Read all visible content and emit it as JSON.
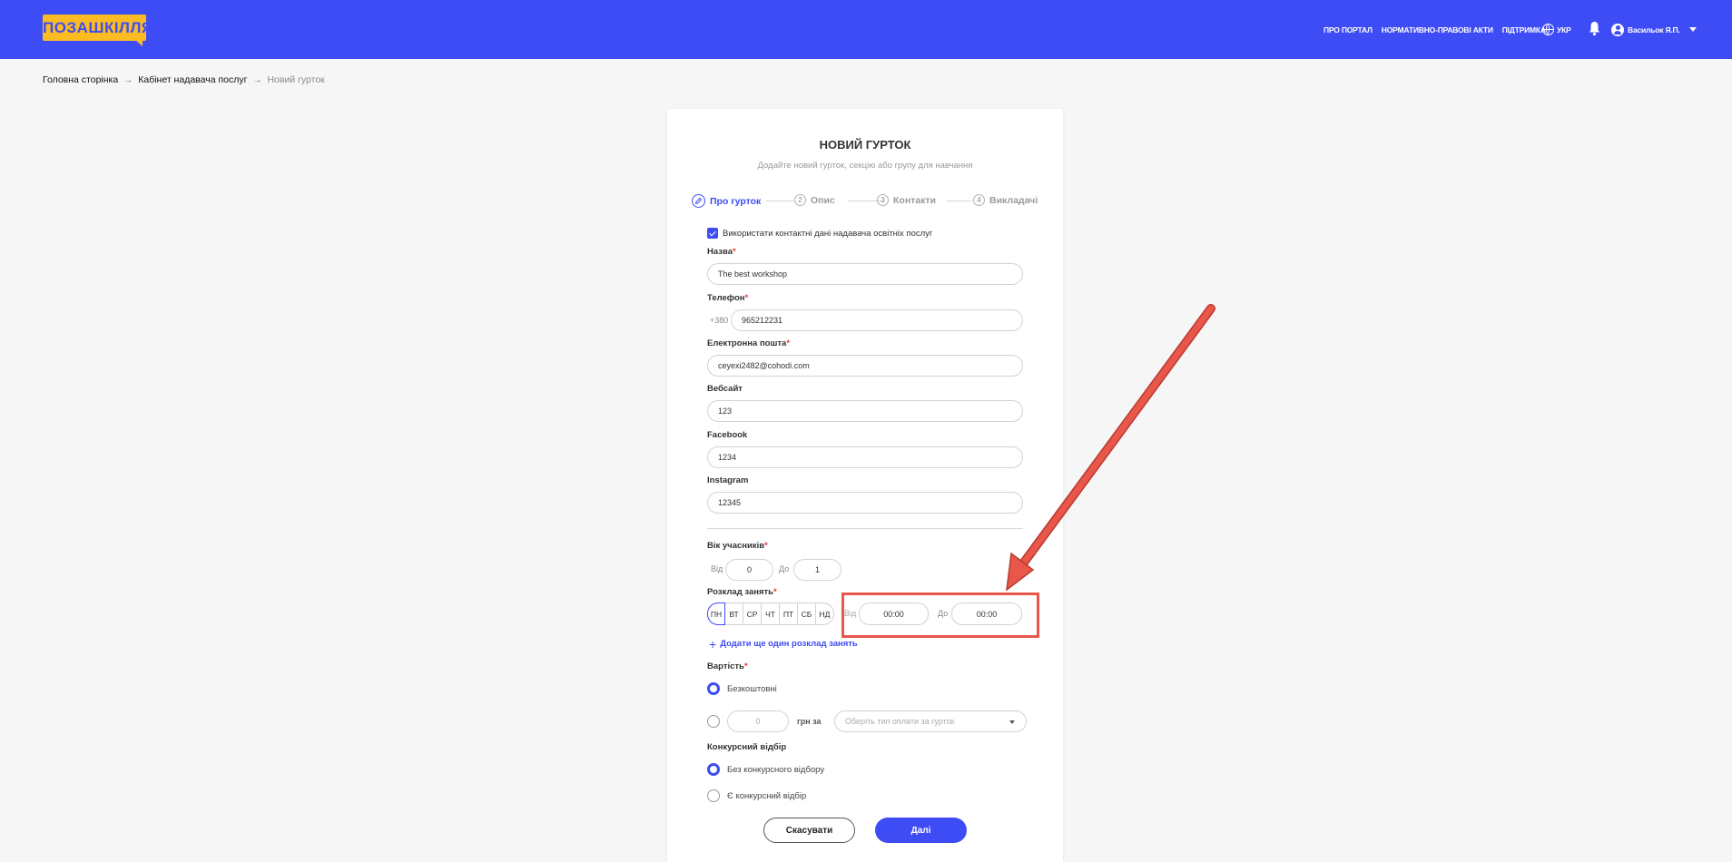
{
  "header": {
    "logo_text": "ПОЗАШКІЛЛЯ",
    "nav": [
      "ПРО ПОРТАЛ",
      "НОРМАТИВНО-ПРАВОВІ АКТИ",
      "ПІДТРИМКА"
    ],
    "language": "УКР",
    "user_name": "Васильок Я.П."
  },
  "breadcrumb": {
    "home": "Головна сторінка",
    "cabinet": "Кабінет надавача послуг",
    "current": "Новий гурток"
  },
  "form": {
    "title": "НОВИЙ ГУРТОК",
    "subtitle": "Додайте новий гурток, секцію або групу для навчання",
    "steps": [
      {
        "num": "",
        "label": "Про гурток",
        "active": true
      },
      {
        "num": "2",
        "label": "Опис"
      },
      {
        "num": "3",
        "label": "Контакти"
      },
      {
        "num": "4",
        "label": "Викладачі"
      }
    ],
    "use_contacts_label": "Використати контактні дані надавача освітніх послуг",
    "name": {
      "label": "Назва",
      "value": "The best workshop"
    },
    "phone": {
      "label": "Телефон",
      "prefix": "+380",
      "value": "965212231"
    },
    "email": {
      "label": "Електронна пошта",
      "value": "ceyexi2482@cohodi.com"
    },
    "website": {
      "label": "Вебсайт",
      "value": "123"
    },
    "facebook": {
      "label": "Facebook",
      "value": "1234"
    },
    "instagram": {
      "label": "Instagram",
      "value": "12345"
    },
    "age": {
      "label": "Вік учасників",
      "from_label": "Від",
      "from_value": "0",
      "to_label": "До",
      "to_value": "1"
    },
    "schedule": {
      "label": "Розклад занять",
      "days": [
        "ПН",
        "ВТ",
        "СР",
        "ЧТ",
        "ПТ",
        "СБ",
        "НД"
      ],
      "from_label": "Від",
      "from_value": "00:00",
      "to_label": "До",
      "to_value": "00:00",
      "add_label": "Додати ще один розклад занять"
    },
    "price": {
      "label": "Вартість",
      "free_label": "Безкоштовні",
      "amount_placeholder": "0",
      "per_label": "грн за",
      "payment_placeholder": "Оберіть тип оплати за гурток"
    },
    "competition": {
      "label": "Конкурсний відбір",
      "option_none": "Без конкурсного відбору",
      "option_yes": "Є конкурсний відбір"
    },
    "cancel_label": "Скасувати",
    "next_label": "Далі"
  },
  "colors": {
    "primary": "#3e4cf5",
    "logo": "#fbbc23",
    "annotation": "#e8574a"
  }
}
